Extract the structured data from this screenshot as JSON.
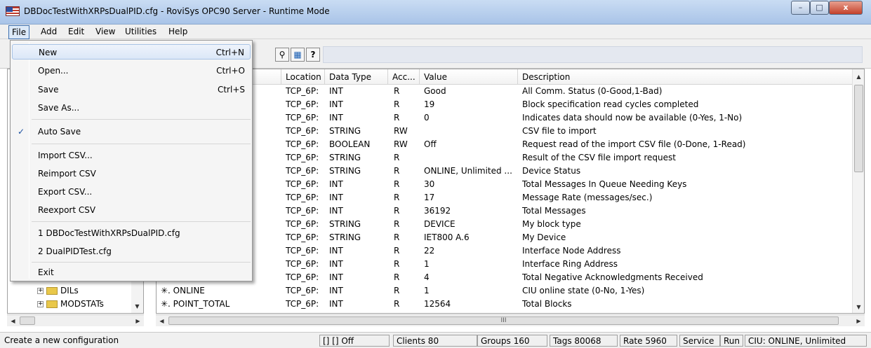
{
  "window": {
    "title": "DBDocTestWithXRPsDualPID.cfg - RoviSys OPC90 Server - Runtime Mode",
    "controls": [
      "minimize-icon",
      "maximize-icon",
      "close-icon"
    ]
  },
  "menubar": {
    "items": [
      "File",
      "Add",
      "Edit",
      "View",
      "Utilities",
      "Help"
    ]
  },
  "toolbar": {
    "buttons": [
      "pin-icon",
      "help-book-icon",
      "whats-this-icon"
    ]
  },
  "file_menu": {
    "items": [
      {
        "label": "New",
        "shortcut": "Ctrl+N",
        "highlighted": true
      },
      {
        "label": "Open...",
        "shortcut": "Ctrl+O"
      },
      {
        "label": "Save",
        "shortcut": "Ctrl+S"
      },
      {
        "label": "Save As...",
        "shortcut": ""
      },
      {
        "label": "Auto Save",
        "shortcut": "",
        "checked": true
      },
      {
        "label": "Import CSV...",
        "shortcut": ""
      },
      {
        "label": "Reimport CSV",
        "shortcut": ""
      },
      {
        "label": "Export CSV...",
        "shortcut": ""
      },
      {
        "label": "Reexport CSV",
        "shortcut": ""
      },
      {
        "label": "1 DBDocTestWithXRPsDualPID.cfg",
        "shortcut": ""
      },
      {
        "label": "2 DualPIDTest.cfg",
        "shortcut": ""
      },
      {
        "label": "Exit",
        "shortcut": ""
      }
    ]
  },
  "tree": {
    "items": [
      {
        "label": "DILs"
      },
      {
        "label": "MODSTATs"
      }
    ]
  },
  "list": {
    "columns": [
      "Location",
      "Data Type",
      "Acc...",
      "Value",
      "Description"
    ],
    "rows": [
      {
        "name": "",
        "location": "TCP_6P:",
        "type": "INT",
        "access": "R",
        "value": "Good",
        "description": "All Comm. Status (0-Good,1-Bad)"
      },
      {
        "name": "",
        "location": "TCP_6P:",
        "type": "INT",
        "access": "R",
        "value": "19",
        "description": "Block specification read cycles completed"
      },
      {
        "name": "",
        "location": "TCP_6P:",
        "type": "INT",
        "access": "R",
        "value": "0",
        "description": "Indicates data should now be available (0-Yes, 1-No)"
      },
      {
        "name": "",
        "location": "TCP_6P:",
        "type": "STRING",
        "access": "RW",
        "value": "",
        "description": "CSV file to import"
      },
      {
        "name": "",
        "location": "TCP_6P:",
        "type": "BOOLEAN",
        "access": "RW",
        "value": "Off",
        "description": "Request read of the import CSV file (0-Done, 1-Read)"
      },
      {
        "name": "",
        "location": "TCP_6P:",
        "type": "STRING",
        "access": "R",
        "value": "",
        "description": "Result of the CSV file import request"
      },
      {
        "name": "",
        "location": "TCP_6P:",
        "type": "STRING",
        "access": "R",
        "value": "ONLINE, Unlimited ...",
        "description": "Device Status"
      },
      {
        "name": "",
        "location": "TCP_6P:",
        "type": "INT",
        "access": "R",
        "value": "30",
        "description": "Total Messages In Queue Needing Keys"
      },
      {
        "name": "",
        "location": "TCP_6P:",
        "type": "INT",
        "access": "R",
        "value": "17",
        "description": "Message Rate (messages/sec.)"
      },
      {
        "name": "",
        "location": "TCP_6P:",
        "type": "INT",
        "access": "R",
        "value": "36192",
        "description": "Total Messages"
      },
      {
        "name": "",
        "location": "TCP_6P:",
        "type": "STRING",
        "access": "R",
        "value": "DEVICE",
        "description": "My block type"
      },
      {
        "name": "",
        "location": "TCP_6P:",
        "type": "STRING",
        "access": "R",
        "value": "IET800 A.6",
        "description": "My Device"
      },
      {
        "name": "",
        "location": "TCP_6P:",
        "type": "INT",
        "access": "R",
        "value": "22",
        "description": "Interface Node Address"
      },
      {
        "name": "",
        "location": "TCP_6P:",
        "type": "INT",
        "access": "R",
        "value": "1",
        "description": "Interface Ring Address"
      },
      {
        "name": "",
        "location": "TCP_6P:",
        "type": "INT",
        "access": "R",
        "value": "4",
        "description": "Total Negative Acknowledgments Received"
      },
      {
        "name": "✳. ONLINE",
        "location": "TCP_6P:",
        "type": "INT",
        "access": "R",
        "value": "1",
        "description": "CIU online state (0-No, 1-Yes)"
      },
      {
        "name": "✳. POINT_TOTAL",
        "location": "TCP_6P:",
        "type": "INT",
        "access": "R",
        "value": "12564",
        "description": "Total Blocks"
      }
    ],
    "hscroll_label": "III"
  },
  "statusbar": {
    "message": "Create a new configuration",
    "flags": "[]  [] Off",
    "clients": "Clients 80",
    "groups": "Groups 160",
    "tags": "Tags 80068",
    "rate": "Rate 5960",
    "service": "Service",
    "run": "Run",
    "ciu": "CIU: ONLINE, Unlimited"
  }
}
